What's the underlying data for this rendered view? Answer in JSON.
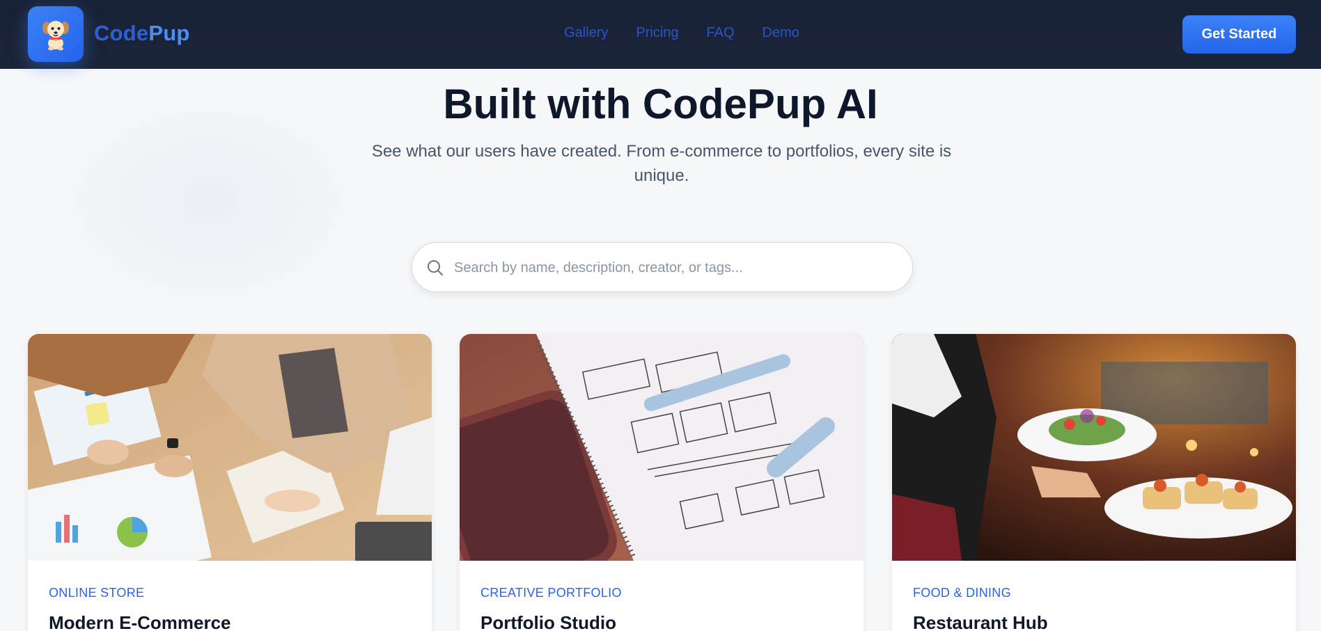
{
  "brand": {
    "part1": "Code",
    "part2": "Pup",
    "logo_icon": "puppy-logo-icon"
  },
  "nav": {
    "links": [
      {
        "label": "Gallery"
      },
      {
        "label": "Pricing"
      },
      {
        "label": "FAQ"
      },
      {
        "label": "Demo"
      }
    ],
    "cta_label": "Get Started"
  },
  "hero": {
    "title": "Built with CodePup AI",
    "subtitle": "See what our users have created. From e-commerce to portfolios, every site is unique."
  },
  "search": {
    "placeholder": "Search by name, description, creator, or tags...",
    "value": "",
    "icon": "search-icon"
  },
  "cards": [
    {
      "category": "ONLINE STORE",
      "title": "Modern E-Commerce"
    },
    {
      "category": "CREATIVE PORTFOLIO",
      "title": "Portfolio Studio"
    },
    {
      "category": "FOOD & DINING",
      "title": "Restaurant Hub"
    }
  ],
  "colors": {
    "nav_bg": "#1b2438",
    "accent": "#2563eb",
    "link": "#2c55c7",
    "heading": "#0f172a"
  }
}
